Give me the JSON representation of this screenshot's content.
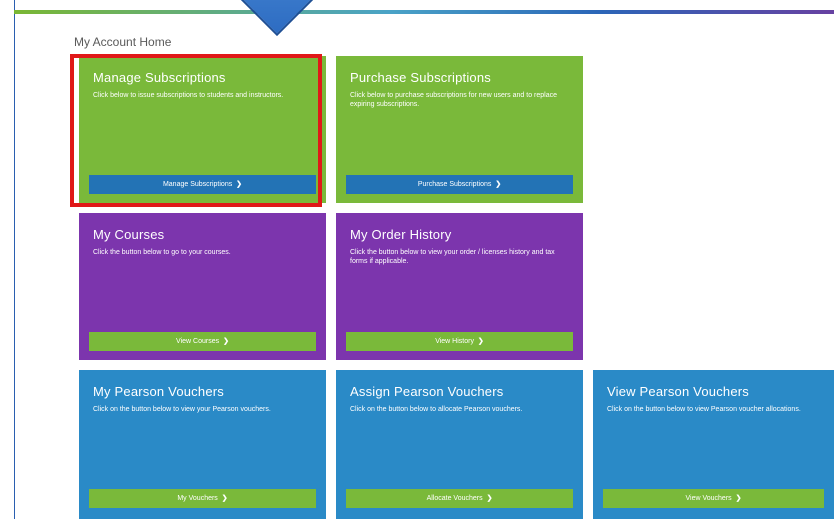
{
  "breadcrumb": "My Account Home",
  "chevron": "❯",
  "tiles": {
    "manage_subscriptions": {
      "title": "Manage Subscriptions",
      "description": "Click below to issue subscriptions to students and instructors.",
      "button": "Manage Subscriptions"
    },
    "purchase_subscriptions": {
      "title": "Purchase Subscriptions",
      "description": "Click below to purchase subscriptions for new users and to replace expiring subscriptions.",
      "button": "Purchase Subscriptions"
    },
    "my_courses": {
      "title": "My Courses",
      "description": "Click the button below to go to your courses.",
      "button": "View Courses"
    },
    "my_order_history": {
      "title": "My Order History",
      "description": "Click the button below to view your order / licenses history and tax forms if applicable.",
      "button": "View History"
    },
    "my_pearson_vouchers": {
      "title": "My Pearson Vouchers",
      "description": "Click on the button below to view your Pearson vouchers.",
      "button": "My Vouchers"
    },
    "assign_pearson_vouchers": {
      "title": "Assign Pearson Vouchers",
      "description": "Click on the button below to allocate Pearson vouchers.",
      "button": "Allocate Vouchers"
    },
    "view_pearson_vouchers": {
      "title": "View Pearson Vouchers",
      "description": "Click on the button below to view Pearson voucher allocations.",
      "button": "View Vouchers"
    }
  },
  "colors": {
    "green": "#7ab93a",
    "purple": "#7c35ad",
    "blue": "#2a8ac7",
    "highlight": "#e01818"
  }
}
